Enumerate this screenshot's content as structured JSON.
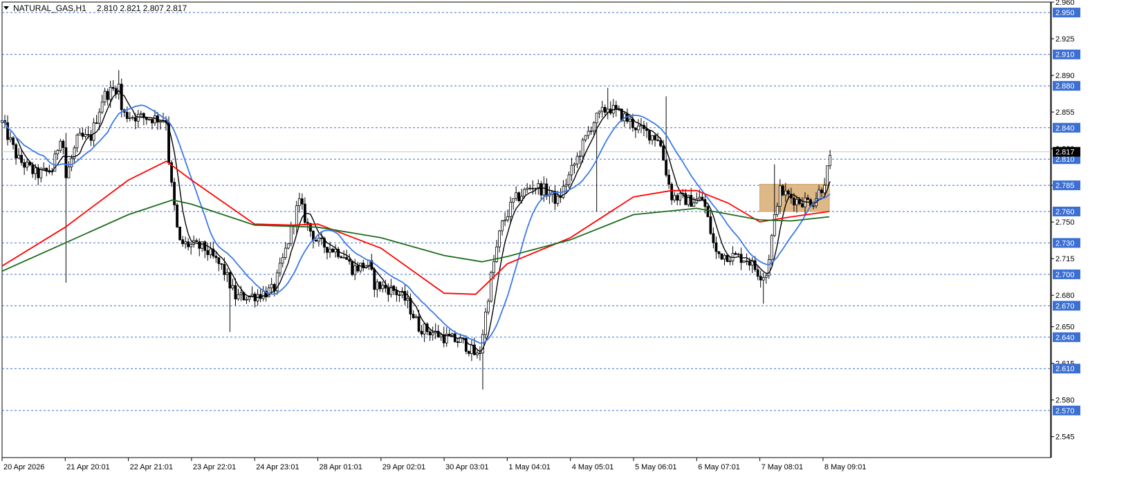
{
  "chart_header": {
    "symbol": "NATURAL_GAS,H1",
    "ohlc": "2.810 2.821 2.807 2.817"
  },
  "chart_data": {
    "type": "candlestick",
    "title": "NATURAL_GAS,H1  2.810 2.821 2.807 2.817",
    "symbol": "NATURAL_GAS",
    "timeframe": "H1",
    "last_price": 2.817,
    "ylim": [
      2.525,
      2.96
    ],
    "y_ticks": [
      2.96,
      2.925,
      2.89,
      2.855,
      2.82,
      2.785,
      2.75,
      2.715,
      2.68,
      2.65,
      2.615,
      2.58,
      2.545
    ],
    "x_ticks": [
      "20 Apr 2026",
      "21 Apr 20:01",
      "22 Apr 21:01",
      "23 Apr 22:01",
      "24 Apr 23:01",
      "28 Apr 01:01",
      "29 Apr 02:01",
      "30 Apr 03:01",
      "1 May 04:01",
      "4 May 05:01",
      "5 May 06:01",
      "6 May 07:01",
      "7 May 08:01",
      "8 May 09:01"
    ],
    "horizontal_levels": [
      2.95,
      2.91,
      2.88,
      2.84,
      2.81,
      2.785,
      2.76,
      2.73,
      2.7,
      2.67,
      2.64,
      2.61,
      2.57
    ],
    "highlight_zone": {
      "from_session": 12,
      "to_session": 13.1,
      "low": 2.76,
      "high": 2.786
    },
    "price_path": [
      {
        "s": 0.0,
        "p": 2.845
      },
      {
        "s": 0.25,
        "p": 2.81
      },
      {
        "s": 0.55,
        "p": 2.795
      },
      {
        "s": 0.8,
        "p": 2.8
      },
      {
        "s": 0.95,
        "p": 2.84
      },
      {
        "s": 1.0,
        "p": 2.79
      },
      {
        "s": 1.2,
        "p": 2.83
      },
      {
        "s": 1.4,
        "p": 2.83
      },
      {
        "s": 1.6,
        "p": 2.87
      },
      {
        "s": 1.85,
        "p": 2.88
      },
      {
        "s": 1.9,
        "p": 2.853
      },
      {
        "s": 2.2,
        "p": 2.85
      },
      {
        "s": 2.6,
        "p": 2.848
      },
      {
        "s": 2.65,
        "p": 2.8
      },
      {
        "s": 2.8,
        "p": 2.73
      },
      {
        "s": 3.2,
        "p": 2.725
      },
      {
        "s": 3.5,
        "p": 2.705
      },
      {
        "s": 3.7,
        "p": 2.678
      },
      {
        "s": 4.0,
        "p": 2.68
      },
      {
        "s": 4.3,
        "p": 2.685
      },
      {
        "s": 4.5,
        "p": 2.725
      },
      {
        "s": 4.7,
        "p": 2.77
      },
      {
        "s": 4.85,
        "p": 2.745
      },
      {
        "s": 5.0,
        "p": 2.73
      },
      {
        "s": 5.4,
        "p": 2.72
      },
      {
        "s": 5.55,
        "p": 2.705
      },
      {
        "s": 5.8,
        "p": 2.71
      },
      {
        "s": 5.9,
        "p": 2.69
      },
      {
        "s": 6.2,
        "p": 2.685
      },
      {
        "s": 6.4,
        "p": 2.675
      },
      {
        "s": 6.6,
        "p": 2.65
      },
      {
        "s": 7.0,
        "p": 2.64
      },
      {
        "s": 7.3,
        "p": 2.635
      },
      {
        "s": 7.55,
        "p": 2.62
      },
      {
        "s": 7.75,
        "p": 2.7
      },
      {
        "s": 7.9,
        "p": 2.745
      },
      {
        "s": 8.1,
        "p": 2.77
      },
      {
        "s": 8.4,
        "p": 2.785
      },
      {
        "s": 8.6,
        "p": 2.78
      },
      {
        "s": 8.8,
        "p": 2.77
      },
      {
        "s": 9.1,
        "p": 2.81
      },
      {
        "s": 9.35,
        "p": 2.845
      },
      {
        "s": 9.6,
        "p": 2.86
      },
      {
        "s": 9.85,
        "p": 2.85
      },
      {
        "s": 10.1,
        "p": 2.838
      },
      {
        "s": 10.4,
        "p": 2.83
      },
      {
        "s": 10.6,
        "p": 2.775
      },
      {
        "s": 10.9,
        "p": 2.77
      },
      {
        "s": 11.1,
        "p": 2.772
      },
      {
        "s": 11.3,
        "p": 2.72
      },
      {
        "s": 11.5,
        "p": 2.718
      },
      {
        "s": 11.8,
        "p": 2.715
      },
      {
        "s": 12.0,
        "p": 2.7
      },
      {
        "s": 12.1,
        "p": 2.7
      },
      {
        "s": 12.3,
        "p": 2.78
      },
      {
        "s": 12.6,
        "p": 2.77
      },
      {
        "s": 12.85,
        "p": 2.77
      },
      {
        "s": 13.0,
        "p": 2.785
      },
      {
        "s": 13.15,
        "p": 2.817
      }
    ],
    "spikes": [
      {
        "s": 1.0,
        "low": 2.692,
        "high": 2.835
      },
      {
        "s": 1.85,
        "high": 2.895
      },
      {
        "s": 3.6,
        "low": 2.645
      },
      {
        "s": 7.6,
        "low": 2.59
      },
      {
        "s": 9.4,
        "low": 2.76
      },
      {
        "s": 9.6,
        "high": 2.878
      },
      {
        "s": 10.5,
        "high": 2.87
      },
      {
        "s": 12.25,
        "high": 2.805
      },
      {
        "s": 12.05,
        "low": 2.672
      }
    ],
    "series": [
      {
        "label": "MA black",
        "color": "#000000",
        "role": "fast"
      },
      {
        "label": "MA blue",
        "color": "#3b79e8",
        "role": "medium"
      },
      {
        "label": "MA red",
        "color": "#ff0000",
        "role": "slow",
        "points": [
          [
            0,
            2.708
          ],
          [
            1,
            2.745
          ],
          [
            2,
            2.79
          ],
          [
            2.6,
            2.808
          ],
          [
            3,
            2.79
          ],
          [
            4,
            2.748
          ],
          [
            4.6,
            2.747
          ],
          [
            5,
            2.748
          ],
          [
            6,
            2.725
          ],
          [
            7,
            2.682
          ],
          [
            7.5,
            2.681
          ],
          [
            8,
            2.71
          ],
          [
            9,
            2.735
          ],
          [
            10,
            2.774
          ],
          [
            10.6,
            2.78
          ],
          [
            11,
            2.78
          ],
          [
            11.5,
            2.768
          ],
          [
            12,
            2.75
          ],
          [
            12.5,
            2.755
          ],
          [
            13.1,
            2.76
          ]
        ]
      },
      {
        "label": "MA dark green",
        "color": "#1a6b1a",
        "role": "slowest",
        "points": [
          [
            0,
            2.703
          ],
          [
            1,
            2.73
          ],
          [
            2,
            2.757
          ],
          [
            2.7,
            2.771
          ],
          [
            3,
            2.767
          ],
          [
            4,
            2.747
          ],
          [
            5,
            2.745
          ],
          [
            6,
            2.735
          ],
          [
            7,
            2.718
          ],
          [
            7.6,
            2.712
          ],
          [
            8,
            2.717
          ],
          [
            9,
            2.733
          ],
          [
            10,
            2.757
          ],
          [
            11,
            2.763
          ],
          [
            12,
            2.752
          ],
          [
            12.5,
            2.751
          ],
          [
            13.1,
            2.755
          ]
        ]
      }
    ],
    "grid": false,
    "price_tag_colors": {
      "level": "#3b6fd4",
      "last": "#000000"
    }
  }
}
